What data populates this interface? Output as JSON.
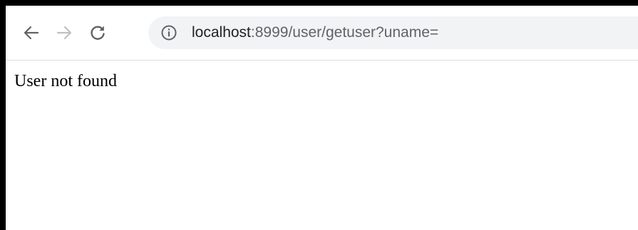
{
  "toolbar": {
    "back_icon": "arrow-left-icon",
    "forward_icon": "arrow-right-icon",
    "reload_icon": "reload-icon",
    "icon_color": "#5f6368",
    "forward_disabled_color": "#bdc1c6"
  },
  "address_bar": {
    "security_icon": "info-icon",
    "host": "localhost",
    "rest": ":8999/user/getuser?uname=",
    "background": "#f1f3f4"
  },
  "page": {
    "message": "User not found"
  }
}
